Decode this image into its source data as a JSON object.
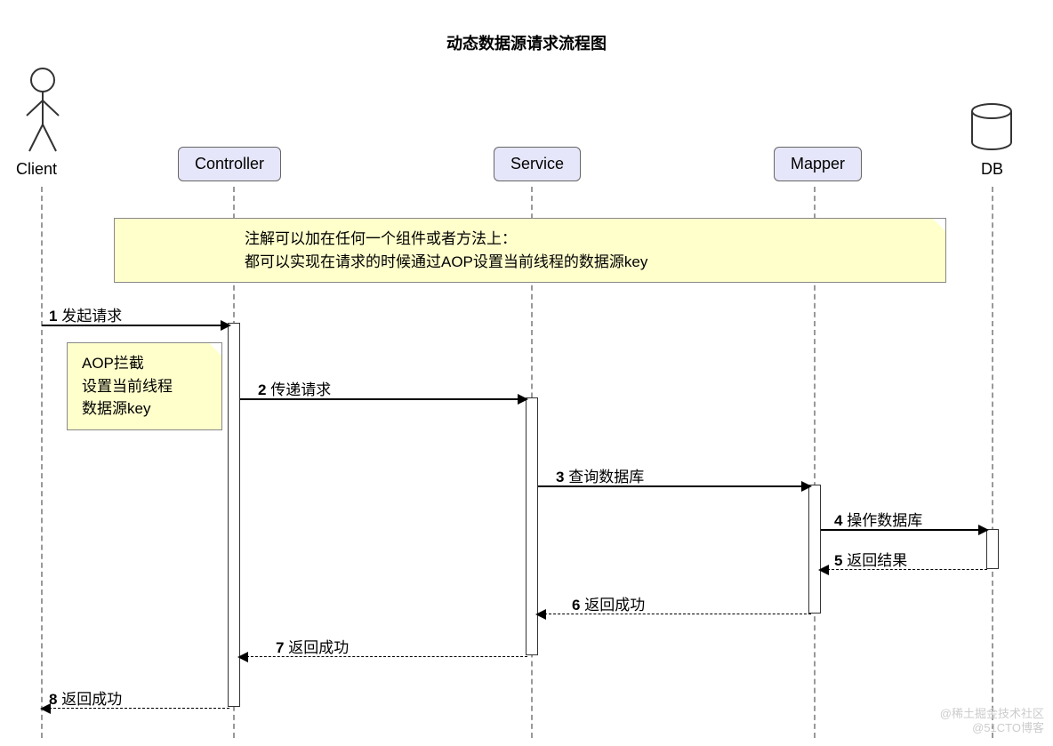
{
  "title": "动态数据源请求流程图",
  "participants": {
    "client": "Client",
    "controller": "Controller",
    "service": "Service",
    "mapper": "Mapper",
    "db": "DB"
  },
  "note_main_line1": "注解可以加在任何一个组件或者方法上：",
  "note_main_line2": "都可以实现在请求的时候通过AOP设置当前线程的数据源key",
  "note_aop_line1": "AOP拦截",
  "note_aop_line2": "设置当前线程",
  "note_aop_line3": "数据源key",
  "messages": {
    "m1_num": "1",
    "m1_text": "发起请求",
    "m2_num": "2",
    "m2_text": "传递请求",
    "m3_num": "3",
    "m3_text": "查询数据库",
    "m4_num": "4",
    "m4_text": "操作数据库",
    "m5_num": "5",
    "m5_text": "返回结果",
    "m6_num": "6",
    "m6_text": "返回成功",
    "m7_num": "7",
    "m7_text": "返回成功",
    "m8_num": "8",
    "m8_text": "返回成功"
  },
  "watermark1": "@稀土掘金技术社区",
  "watermark2": "@51CTO博客"
}
